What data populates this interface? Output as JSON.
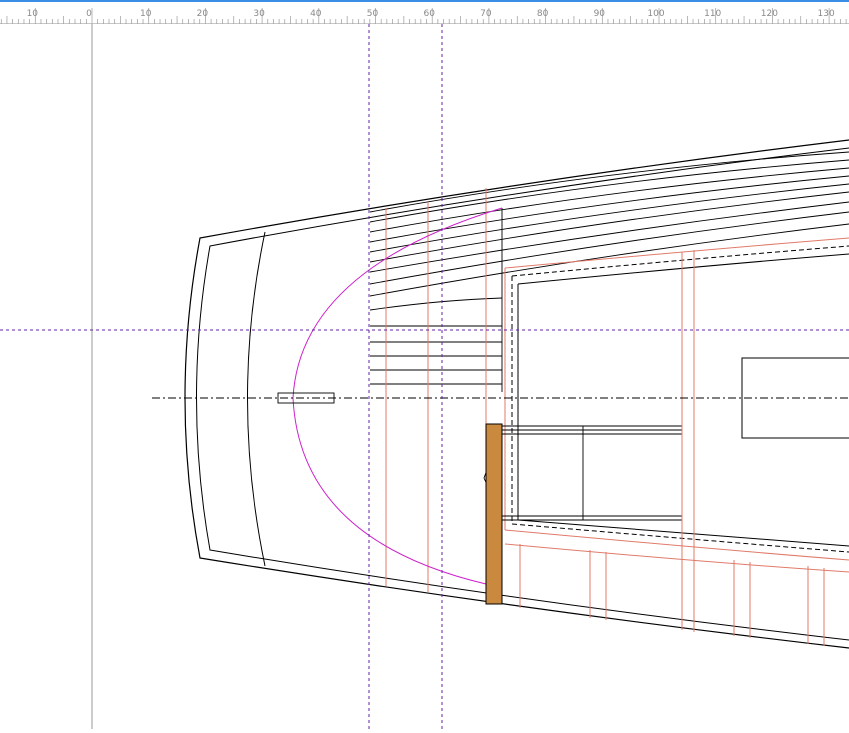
{
  "ruler": {
    "unit_step": 10,
    "labels": [
      "10",
      "0",
      "10",
      "20",
      "30",
      "40",
      "50",
      "60",
      "70",
      "80",
      "90",
      "100",
      "110",
      "120",
      "130"
    ]
  },
  "colors": {
    "ruler_accent": "#3a8ee6",
    "outline": "#000000",
    "frame_lines": "#e07a6a",
    "curve": "#cc22cc",
    "guides": "#6622aa",
    "bulkhead": "#c98a3f",
    "origin_axis": "#999999"
  },
  "guides": {
    "vertical_positions_mm": [
      49,
      62
    ],
    "horizontal_guide_count": 1
  }
}
